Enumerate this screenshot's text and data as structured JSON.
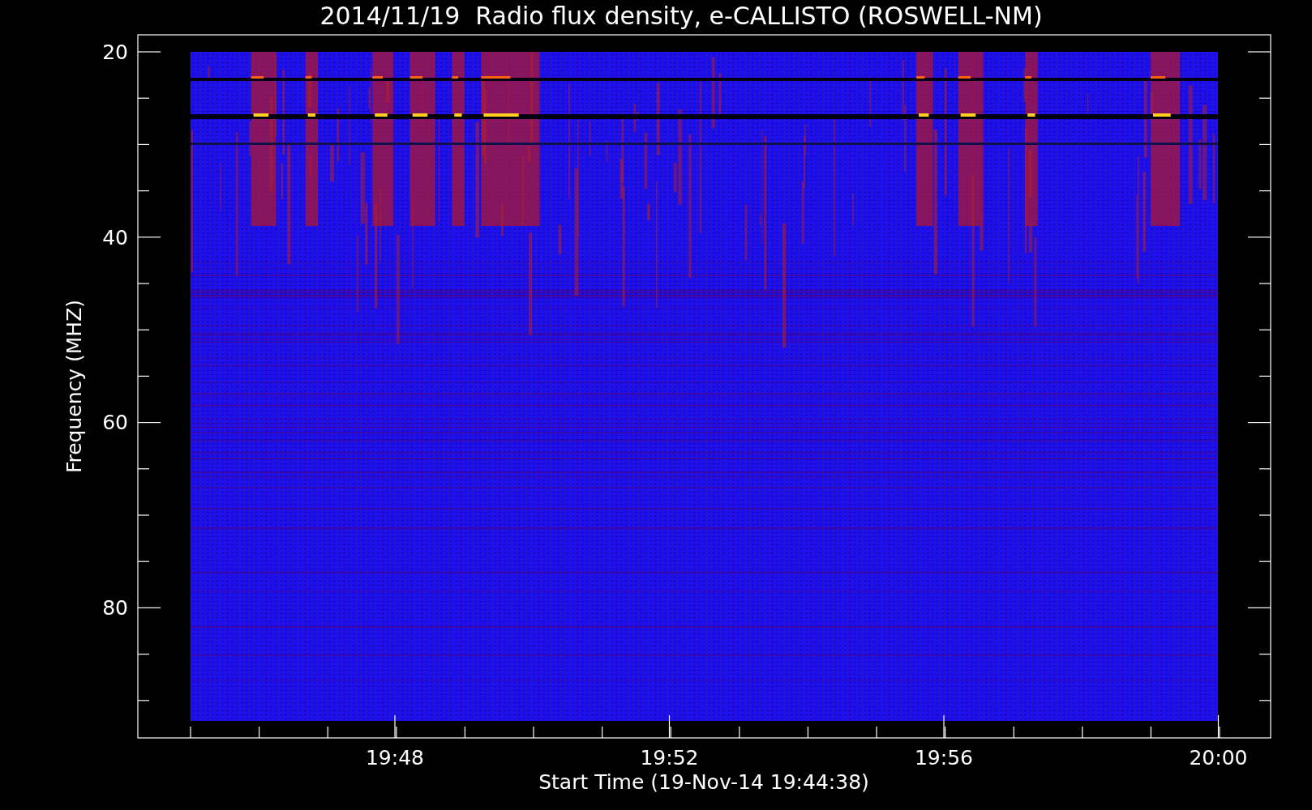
{
  "title": "2014/11/19  Radio flux density, e-CALLISTO (ROSWELL-NM)",
  "y_axis": {
    "label": "Frequency (MHZ)",
    "ticks": [
      "20",
      "40",
      "60",
      "80"
    ]
  },
  "x_axis": {
    "label": "Start Time (19-Nov-14 19:44:38)",
    "ticks": [
      "19:48",
      "19:52",
      "19:56",
      "20:00"
    ]
  }
}
